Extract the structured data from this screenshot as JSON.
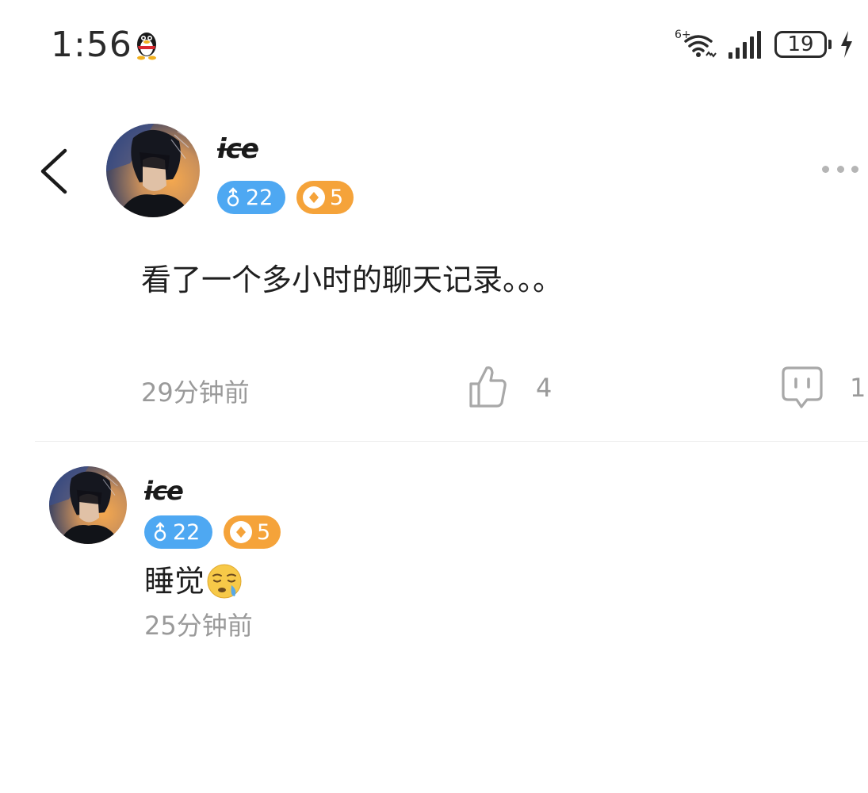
{
  "status_bar": {
    "time": "1:56",
    "network_label": "6+",
    "battery_level": "19"
  },
  "post": {
    "author": {
      "name": "ice",
      "age_badge": "22",
      "level_badge": "5"
    },
    "content": "看了一个多小时的聊天记录。。。",
    "time": "29分钟前",
    "like_count": "4",
    "comment_count": "1"
  },
  "replies": [
    {
      "author": {
        "name": "ice",
        "age_badge": "22",
        "level_badge": "5"
      },
      "content": "睡觉",
      "emoji": "sleepy-face",
      "time": "25分钟前"
    }
  ],
  "colors": {
    "age_badge": "#4ea8f2",
    "level_badge": "#f5a33a",
    "meta_text": "#9a9a9a",
    "icon_gray": "#a8a8a8"
  }
}
